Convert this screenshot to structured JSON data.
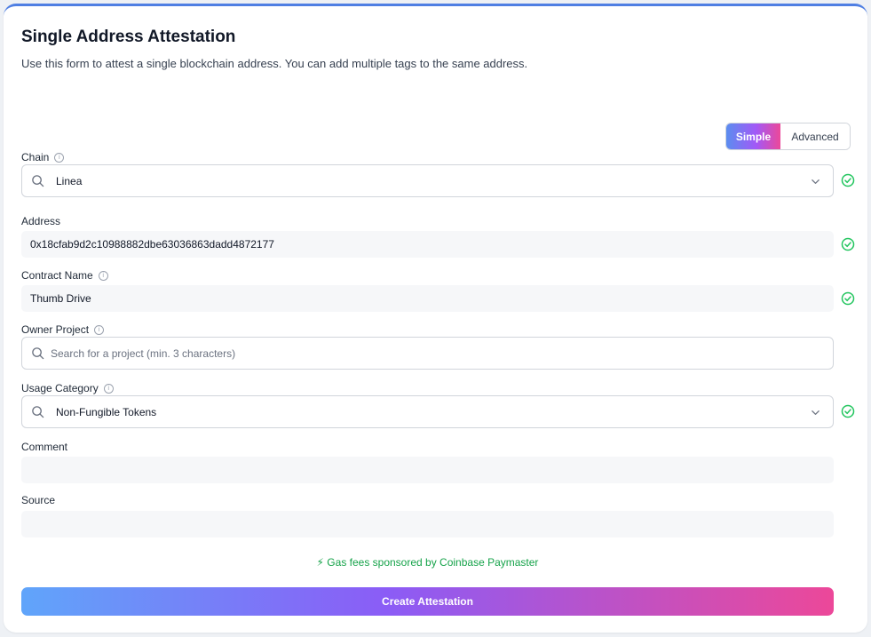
{
  "header": {
    "title": "Single Address Attestation",
    "subtitle": "Use this form to attest a single blockchain address. You can add multiple tags to the same address."
  },
  "mode_toggle": {
    "simple_label": "Simple",
    "advanced_label": "Advanced",
    "selected": "Simple"
  },
  "fields": {
    "chain": {
      "label": "Chain",
      "value": "Linea",
      "valid": true
    },
    "address": {
      "label": "Address",
      "value": "0x18cfab9d2c10988882dbe63036863dadd4872177",
      "valid": true
    },
    "contract_name": {
      "label": "Contract Name",
      "value": "Thumb Drive",
      "valid": true
    },
    "owner_project": {
      "label": "Owner Project",
      "placeholder": "Search for a project (min. 3 characters)",
      "value": ""
    },
    "usage_category": {
      "label": "Usage Category",
      "value": "Non-Fungible Tokens",
      "valid": true
    },
    "comment": {
      "label": "Comment",
      "value": ""
    },
    "source": {
      "label": "Source",
      "value": ""
    }
  },
  "footer": {
    "gas_note": "⚡ Gas fees sponsored by Coinbase Paymaster",
    "submit_label": "Create Attestation"
  },
  "colors": {
    "accent_blue": "#60a5fa",
    "accent_purple": "#8b5cf6",
    "accent_pink": "#ec4899",
    "valid_green": "#22c55e"
  }
}
